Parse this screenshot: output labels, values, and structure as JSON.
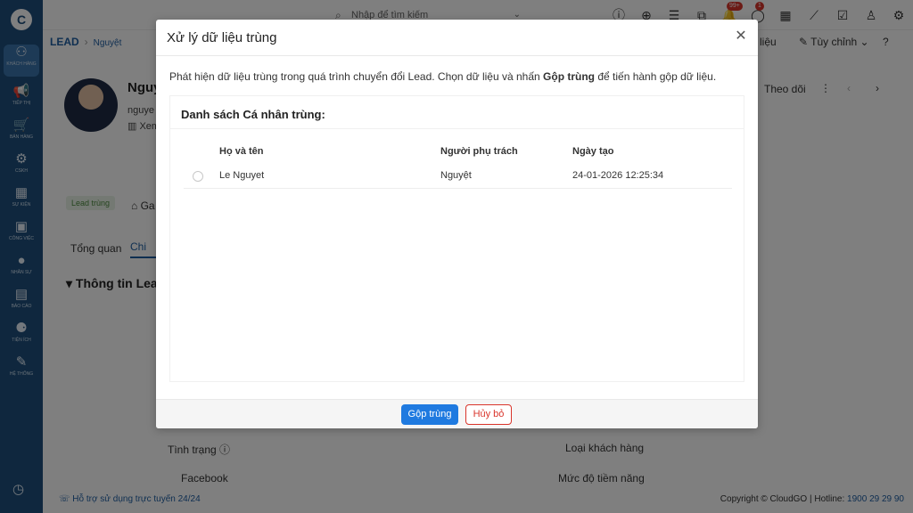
{
  "sidebar": {
    "items": [
      {
        "icon": "people-icon",
        "glyph": "⚇",
        "label": "Khách hàng"
      },
      {
        "icon": "megaphone-icon",
        "glyph": "📢",
        "label": "Tiếp thị"
      },
      {
        "icon": "cart-icon",
        "glyph": "🛒",
        "label": "Bán hàng"
      },
      {
        "icon": "support-icon",
        "glyph": "⚙",
        "label": "CSKH"
      },
      {
        "icon": "calendar-icon",
        "glyph": "▦",
        "label": "Sự kiện"
      },
      {
        "icon": "briefcase-icon",
        "glyph": "▣",
        "label": "Công việc"
      },
      {
        "icon": "person-icon",
        "glyph": "●",
        "label": "Nhân sự"
      },
      {
        "icon": "report-icon",
        "glyph": "▤",
        "label": "Báo cáo"
      },
      {
        "icon": "team-icon",
        "glyph": "⚈",
        "label": "Tiện ích"
      },
      {
        "icon": "wrench-icon",
        "glyph": "✎",
        "label": "Hệ thống"
      }
    ]
  },
  "topbar": {
    "search_placeholder": "Nhập để tìm kiếm",
    "notification_badge": "99+",
    "message_badge": "1"
  },
  "background": {
    "breadcrumb_module": "LEAD",
    "breadcrumb_current": "Nguyệt",
    "name_partial": "Nguy",
    "email_partial": "nguye",
    "view_partial": "Xem",
    "header_link_partial": "liệu",
    "customize_label": "Tùy chỉnh",
    "follow_label": "Theo dõi",
    "tag_label": "Lead trùng",
    "tag2_partial": "Ga",
    "tab_overview": "Tổng quan",
    "tab_detail_partial": "Chi",
    "section_title_partial": "Thông tin Lea",
    "field_status": "Tình trạng",
    "field_customer_type": "Loại khách hàng",
    "field_facebook": "Facebook",
    "field_potential": "Mức độ tiềm năng"
  },
  "footer": {
    "help": "Hỗ trợ sử dụng trực tuyến 24/24",
    "copyright": "Copyright © CloudGO | Hotline: ",
    "hotline": "1900 29 29 90"
  },
  "modal": {
    "title": "Xử lý dữ liệu trùng",
    "desc_part1": "Phát hiện dữ liệu trùng trong quá trình chuyển đổi Lead. Chọn dữ liệu và nhấn ",
    "desc_bold": "Gộp trùng",
    "desc_part2": " để tiến hành gộp dữ liệu.",
    "panel_title": "Danh sách Cá nhân trùng:",
    "columns": [
      "Họ và tên",
      "Người phụ trách",
      "Ngày tạo"
    ],
    "rows": [
      {
        "name": "Le Nguyet",
        "owner": "Nguyệt",
        "created": "24-01-2026 12:25:34"
      }
    ],
    "merge_button": "Gộp trùng",
    "cancel_button": "Hủy bỏ"
  }
}
